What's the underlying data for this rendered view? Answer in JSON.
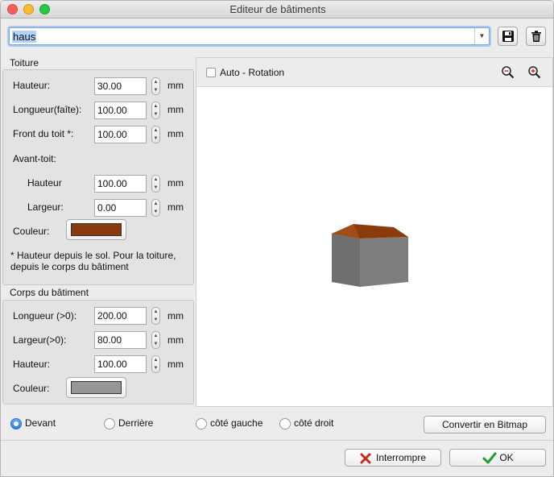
{
  "window": {
    "title": "Editeur de bâtiments"
  },
  "building_select": {
    "value": "haus"
  },
  "toiture": {
    "title": "Toiture",
    "hauteur": {
      "label": "Hauteur:",
      "value": "30.00",
      "unit": "mm"
    },
    "longueur": {
      "label": "Longueur(faîte):",
      "value": "100.00",
      "unit": "mm"
    },
    "front": {
      "label": "Front du toit *:",
      "value": "100.00",
      "unit": "mm"
    },
    "avant_toit_label": "Avant-toit:",
    "av_hauteur": {
      "label": "Hauteur",
      "value": "100.00",
      "unit": "mm"
    },
    "av_largeur": {
      "label": "Largeur:",
      "value": "0.00",
      "unit": "mm"
    },
    "couleur": {
      "label": "Couleur:",
      "color": "#8b3a0e"
    },
    "note": "* Hauteur depuis le sol. Pour la toiture, depuis le corps du bâtiment"
  },
  "corps": {
    "title": "Corps du bâtiment",
    "longueur": {
      "label": "Longueur (>0):",
      "value": "200.00",
      "unit": "mm"
    },
    "largeur": {
      "label": "Largeur(>0):",
      "value": "80.00",
      "unit": "mm"
    },
    "hauteur": {
      "label": "Hauteur:",
      "value": "100.00",
      "unit": "mm"
    },
    "couleur": {
      "label": "Couleur:",
      "color": "#969696"
    }
  },
  "viewer": {
    "auto_rotation": {
      "label": "Auto - Rotation",
      "checked": false
    },
    "icons": [
      "zoom-out-icon",
      "zoom-in-icon"
    ]
  },
  "views": {
    "selected": "Devant",
    "options": [
      "Devant",
      "Derrière",
      "côté gauche",
      "côté droit"
    ]
  },
  "buttons": {
    "convert": "Convertir en Bitmap",
    "cancel": "Interrompre",
    "ok": "OK"
  }
}
